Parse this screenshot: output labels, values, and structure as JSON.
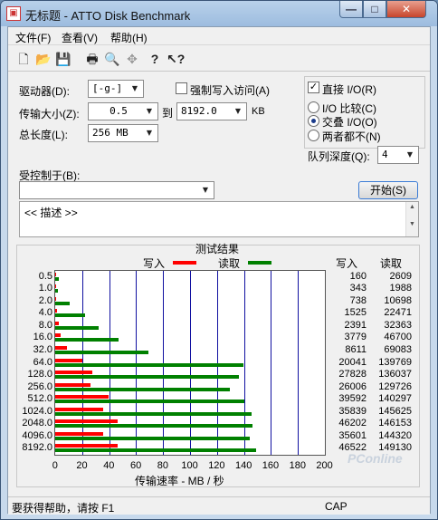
{
  "window": {
    "title": "无标题 - ATTO Disk Benchmark",
    "min_glyph": "—",
    "max_glyph": "□",
    "close_glyph": "✕"
  },
  "menu": [
    {
      "label": "文件(F)"
    },
    {
      "label": "查看(V)"
    },
    {
      "label": "帮助(H)"
    }
  ],
  "toolbar_icons": [
    "new-file-icon",
    "open-folder-icon",
    "save-icon",
    "print-icon",
    "print-preview-icon",
    "move-icon",
    "help-icon",
    "context-help-icon"
  ],
  "form": {
    "drive_label": "驱动器(D):",
    "drive_value": "[-g-]",
    "force_write_label": "强制写入访问(A)",
    "transfer_label": "传输大小(Z):",
    "transfer_from": "0.5",
    "to_label": "到",
    "transfer_to": "8192.0",
    "kb_label": "KB",
    "total_length_label": "总长度(L):",
    "total_length_value": "256 MB",
    "direct_io_label": "直接 I/O(R)",
    "io_compare_label": "I/O 比较(C)",
    "overlap_io_label": "交叠 I/O(O)",
    "neither_label": "两者都不(N)",
    "queue_depth_label": "队列深度(Q):",
    "queue_depth_value": "4",
    "controlled_by_label": "受控制于(B):",
    "controlled_by_value": "",
    "start_label": "开始(S)",
    "description": "<< 描述 >>"
  },
  "results": {
    "title": "测试结果",
    "write_legend": "写入",
    "read_legend": "读取",
    "write_header": "写入",
    "read_header": "读取",
    "xlabel": "传输速率 - MB / 秒",
    "xticks": [
      "0",
      "20",
      "40",
      "60",
      "80",
      "100",
      "120",
      "140",
      "160",
      "180",
      "200"
    ]
  },
  "colors": {
    "write": "#ff0000",
    "read": "#008000",
    "grid": "#1010a0"
  },
  "chart_data": {
    "type": "bar",
    "orientation": "horizontal",
    "categories": [
      "0.5",
      "1.0",
      "2.0",
      "4.0",
      "8.0",
      "16.0",
      "32.0",
      "64.0",
      "128.0",
      "256.0",
      "512.0",
      "1024.0",
      "2048.0",
      "4096.0",
      "8192.0"
    ],
    "xlim": [
      0,
      200
    ],
    "series": [
      {
        "name": "写入",
        "values": [
          0.16,
          0.34,
          0.74,
          1.53,
          2.39,
          3.78,
          8.61,
          20.04,
          27.83,
          26.01,
          39.59,
          35.84,
          46.2,
          35.6,
          46.52
        ]
      },
      {
        "name": "读取",
        "values": [
          2.61,
          1.99,
          10.7,
          22.47,
          32.36,
          46.7,
          69.08,
          139.77,
          136.04,
          129.73,
          140.3,
          145.63,
          146.15,
          144.32,
          149.13
        ]
      }
    ],
    "table": {
      "write": [
        "160",
        "343",
        "738",
        "1525",
        "2391",
        "3779",
        "8611",
        "20041",
        "27828",
        "26006",
        "39592",
        "35839",
        "46202",
        "35601",
        "46522"
      ],
      "read": [
        "2609",
        "1988",
        "10698",
        "22471",
        "32363",
        "46700",
        "69083",
        "139769",
        "136037",
        "129726",
        "140297",
        "145625",
        "146153",
        "144320",
        "149130"
      ]
    }
  },
  "status": {
    "help_text": "要获得帮助，请按 F1",
    "cap": "CAP"
  },
  "watermark": "PConline"
}
